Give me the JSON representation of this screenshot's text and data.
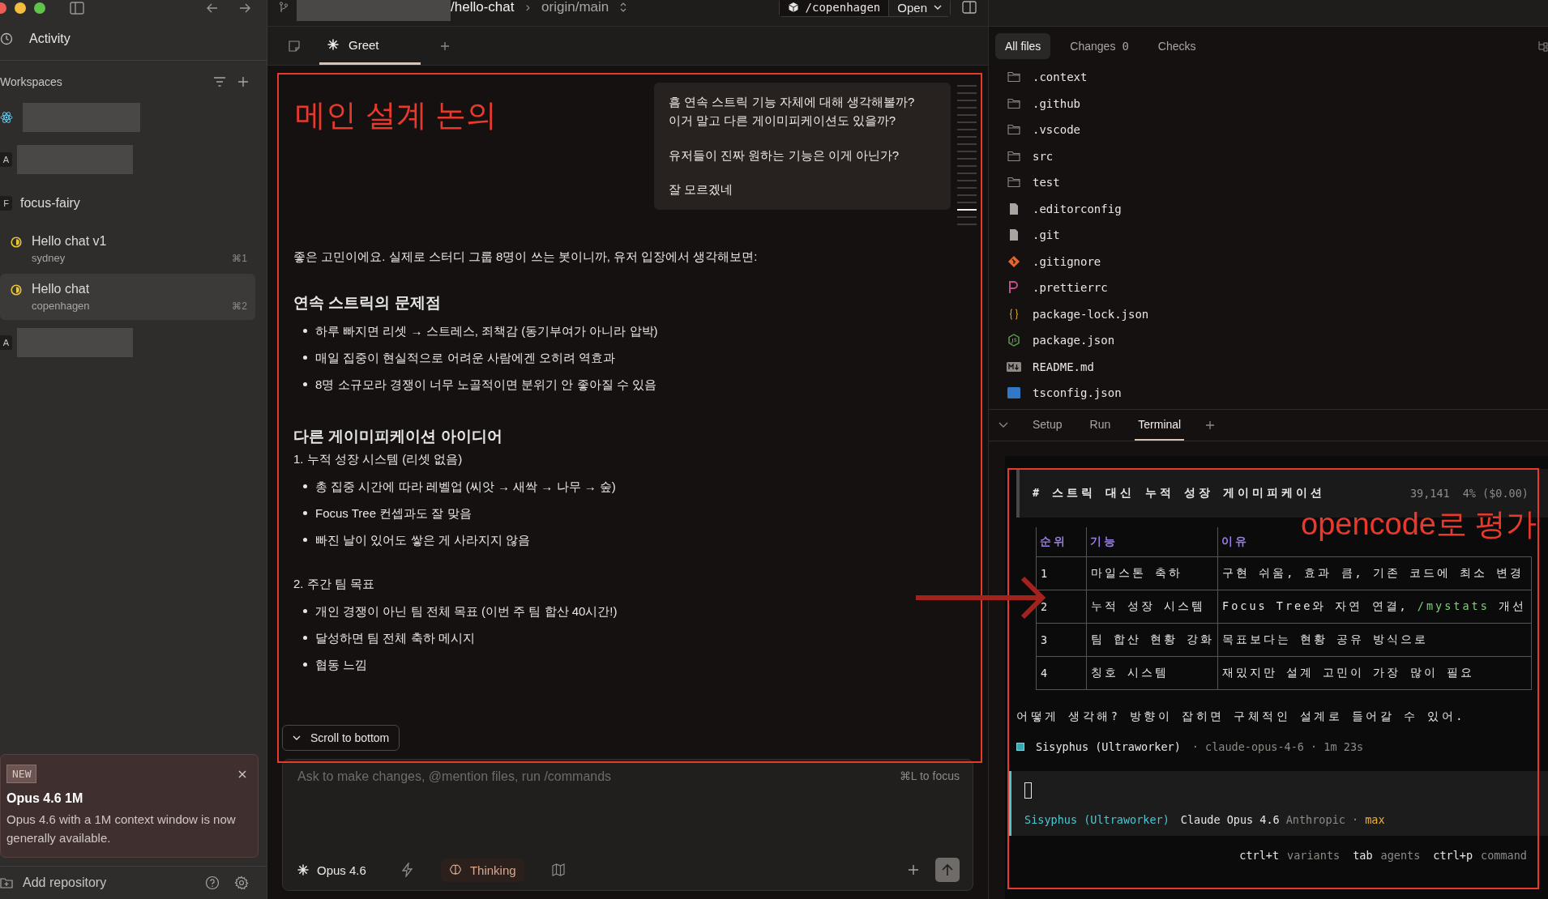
{
  "sidebar": {
    "activity": "Activity",
    "workspaces_label": "Workspaces",
    "items": [
      {
        "kind": "hidden"
      },
      {
        "kind": "hidden",
        "badge": "A"
      },
      {
        "kind": "workspace",
        "badge": "F",
        "name": "focus-fairy"
      },
      {
        "kind": "chat",
        "title": "Hello chat v1",
        "subtitle": "sydney",
        "shortcut": "⌘1",
        "selected": false
      },
      {
        "kind": "chat",
        "title": "Hello chat",
        "subtitle": "copenhagen",
        "shortcut": "⌘2",
        "selected": true
      },
      {
        "kind": "hidden",
        "badge": "A"
      }
    ],
    "notice": {
      "badge": "NEW",
      "title": "Opus 4.6 1M",
      "body": "Opus 4.6 with a 1M context window is now generally available."
    },
    "add_repository": "Add repository"
  },
  "top_bar": {
    "repo_path": "/hello-chat",
    "separator": "›",
    "branch": "origin/main",
    "workspace_button": "/copenhagen",
    "open_button": "Open"
  },
  "tabs": [
    {
      "label": "Greet",
      "selected": true
    }
  ],
  "chat": {
    "user_message": [
      "흠 연속 스트릭 기능 자체에 대해 생각해볼까?\n이거 말고 다른 게이미피케이션도 있을까?",
      "유저들이 진짜 원하는 기능은 이게 아닌가?",
      "잘 모르겠네"
    ],
    "response": [
      {
        "kind": "paragraph",
        "text": "좋은 고민이에요. 실제로 스터디 그룹 8명이 쓰는 봇이니까, 유저 입장에서 생각해보면:"
      },
      {
        "kind": "heading",
        "text": "연속 스트릭의 문제점"
      },
      {
        "kind": "bullets",
        "items": [
          "하루 빠지면 리셋 → 스트레스, 죄책감 (동기부여가 아니라 압박)",
          "매일 집중이 현실적으로 어려운 사람에겐 오히려 역효과",
          "8명 소규모라 경쟁이 너무 노골적이면 분위기 안 좋아질 수 있음"
        ]
      },
      {
        "kind": "heading",
        "text": "다른 게이미피케이션 아이디어"
      },
      {
        "kind": "subheading",
        "text": "1. 누적 성장 시스템 (리셋 없음)"
      },
      {
        "kind": "bullets",
        "items": [
          "총 집중 시간에 따라 레벨업 (씨앗 → 새싹 → 나무 → 숲)",
          "Focus Tree 컨셉과도 잘 맞음",
          "빠진 날이 있어도 쌓은 게 사라지지 않음"
        ]
      },
      {
        "kind": "subheading",
        "text": "2. 주간 팀 목표"
      },
      {
        "kind": "bullets",
        "items": [
          "개인 경쟁이 아닌 팀 전체 목표 (이번 주 팀 합산 40시간!)",
          "달성하면 팀 전체 축하 메시지",
          "협동 느낌"
        ]
      }
    ],
    "scroll_button": "Scroll to bottom"
  },
  "composer": {
    "placeholder": "Ask to make changes, @mention files, run /commands",
    "focus_hint": "⌘L to focus",
    "model": "Opus 4.6",
    "thinking": "Thinking"
  },
  "file_tabs": [
    {
      "label": "All files",
      "selected": true
    },
    {
      "label": "Changes",
      "count": "0",
      "selected": false
    },
    {
      "label": "Checks",
      "selected": false
    }
  ],
  "files": [
    {
      "name": ".context",
      "kind": "folder"
    },
    {
      "name": ".github",
      "kind": "folder"
    },
    {
      "name": ".vscode",
      "kind": "folder"
    },
    {
      "name": "src",
      "kind": "folder"
    },
    {
      "name": "test",
      "kind": "folder"
    },
    {
      "name": ".editorconfig",
      "kind": "file"
    },
    {
      "name": ".git",
      "kind": "file"
    },
    {
      "name": ".gitignore",
      "kind": "git"
    },
    {
      "name": ".prettierrc",
      "kind": "prettier"
    },
    {
      "name": "package-lock.json",
      "kind": "json"
    },
    {
      "name": "package.json",
      "kind": "node"
    },
    {
      "name": "README.md",
      "kind": "markdown"
    },
    {
      "name": "tsconfig.json",
      "kind": "typescript"
    }
  ],
  "panel_tabs": [
    {
      "label": "Setup",
      "selected": false
    },
    {
      "label": "Run",
      "selected": false
    },
    {
      "label": "Terminal",
      "selected": true
    }
  ],
  "terminal": {
    "title": "# 스트릭 대신 누적 성장 게이미피케이션",
    "tokens": "39,141",
    "usage": "4% ($0.00)",
    "table": {
      "columns": [
        "순위",
        "기능",
        "이유"
      ],
      "rows": [
        {
          "rank": "1",
          "feature": "마일스톤 축하",
          "reason": [
            {
              "kind": "plain",
              "text": "구현 쉬움, 효과 큼, 기존 코드에 최소 변경"
            }
          ]
        },
        {
          "rank": "2",
          "feature": "누적 성장 시스템",
          "reason": [
            {
              "kind": "plain",
              "text": "Focus Tree와 자연 연결, "
            },
            {
              "kind": "command",
              "text": "/mystats"
            },
            {
              "kind": "plain",
              "text": " 개선"
            }
          ]
        },
        {
          "rank": "3",
          "feature": "팀 합산 현황 강화",
          "reason": [
            {
              "kind": "plain",
              "text": "목표보다는 현황 공유 방식으로"
            }
          ]
        },
        {
          "rank": "4",
          "feature": "칭호 시스템",
          "reason": [
            {
              "kind": "plain",
              "text": "재밌지만 설계 고민이 가장 많이 필요"
            }
          ]
        }
      ]
    },
    "question": "어떻게 생각해? 방향이 잡히면 구체적인 설계로 들어갈 수 있어.",
    "agent": "Sisyphus (Ultraworker)",
    "agent_meta": "· claude-opus-4-6 · 1m 23s",
    "prompt": {
      "agent": "Sisyphus (Ultraworker)",
      "model": "Claude Opus 4.6",
      "provider": "Anthropic ·",
      "variant": "max"
    },
    "hints": [
      {
        "key": "ctrl+t",
        "label": "variants"
      },
      {
        "key": "tab",
        "label": "agents"
      },
      {
        "key": "ctrl+p",
        "label": "command"
      }
    ]
  },
  "annotations": {
    "chat_title": "메인 설계 논의",
    "terminal_note": "opencode로 평가"
  }
}
